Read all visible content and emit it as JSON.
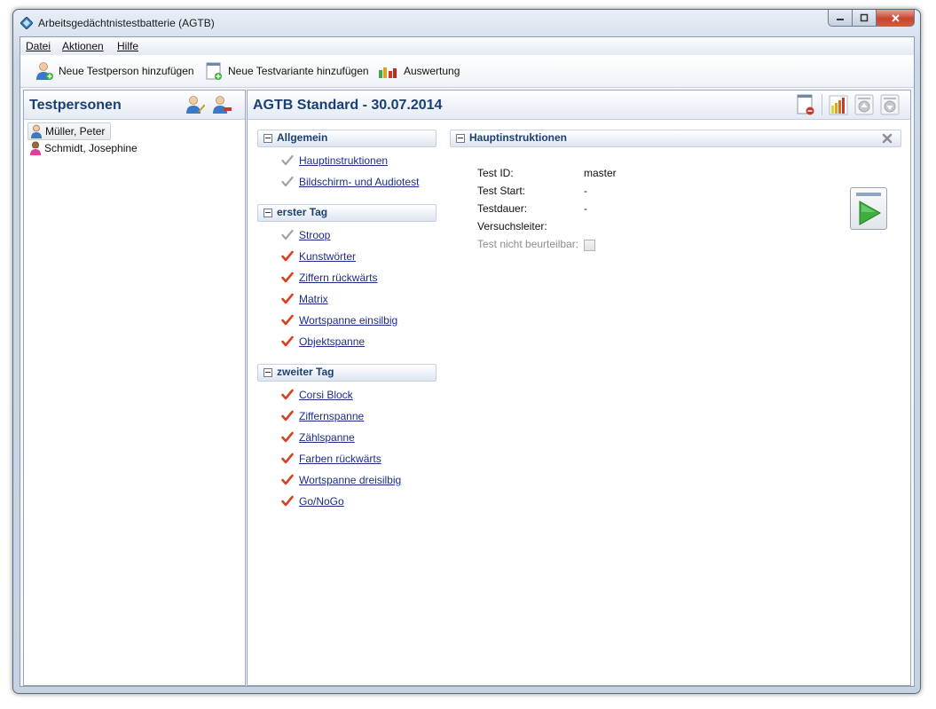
{
  "window": {
    "title": "Arbeitsgedächtnistestbatterie (AGTB)"
  },
  "menu": {
    "items": [
      "Datei",
      "Aktionen",
      "Hilfe"
    ]
  },
  "toolbar": {
    "new_person": "Neue Testperson hinzufügen",
    "new_variant": "Neue Testvariante hinzufügen",
    "evaluation": "Auswertung"
  },
  "persons_panel": {
    "title": "Testpersonen",
    "persons": [
      {
        "name": "Müller, Peter",
        "gender": "male",
        "selected": true
      },
      {
        "name": "Schmidt, Josephine",
        "gender": "female",
        "selected": false
      }
    ]
  },
  "main": {
    "title": "AGTB Standard - 30.07.2014",
    "sections": [
      {
        "label": "Allgemein",
        "items": [
          {
            "label": "Hauptinstruktionen",
            "status": "gray"
          },
          {
            "label": "Bildschirm- und Audiotest",
            "status": "gray"
          }
        ]
      },
      {
        "label": "erster Tag",
        "items": [
          {
            "label": "Stroop",
            "status": "gray"
          },
          {
            "label": "Kunstwörter",
            "status": "red"
          },
          {
            "label": "Ziffern rückwärts",
            "status": "red"
          },
          {
            "label": "Matrix",
            "status": "red"
          },
          {
            "label": "Wortspanne einsilbig",
            "status": "red"
          },
          {
            "label": "Objektspanne",
            "status": "red"
          }
        ]
      },
      {
        "label": "zweiter Tag",
        "items": [
          {
            "label": "Corsi Block",
            "status": "red"
          },
          {
            "label": "Ziffernspanne",
            "status": "red"
          },
          {
            "label": "Zählspanne",
            "status": "red"
          },
          {
            "label": "Farben rückwärts",
            "status": "red"
          },
          {
            "label": "Wortspanne dreisilbig",
            "status": "red"
          },
          {
            "label": "Go/NoGo",
            "status": "red"
          }
        ]
      }
    ],
    "detail": {
      "title": "Hauptinstruktionen",
      "test_id_label": "Test ID:",
      "test_id_value": "master",
      "start_label": "Test Start:",
      "start_value": "-",
      "duration_label": "Testdauer:",
      "duration_value": "-",
      "supervisor_label": "Versuchsleiter:",
      "supervisor_value": "",
      "not_ratable_label": "Test nicht beurteilbar:"
    }
  },
  "colors": {
    "header_text": "#1b3f73",
    "link": "#1a2d8a",
    "check_red": "#d9411e",
    "check_gray": "#9a9a9a",
    "play_green": "#3fae3f"
  }
}
